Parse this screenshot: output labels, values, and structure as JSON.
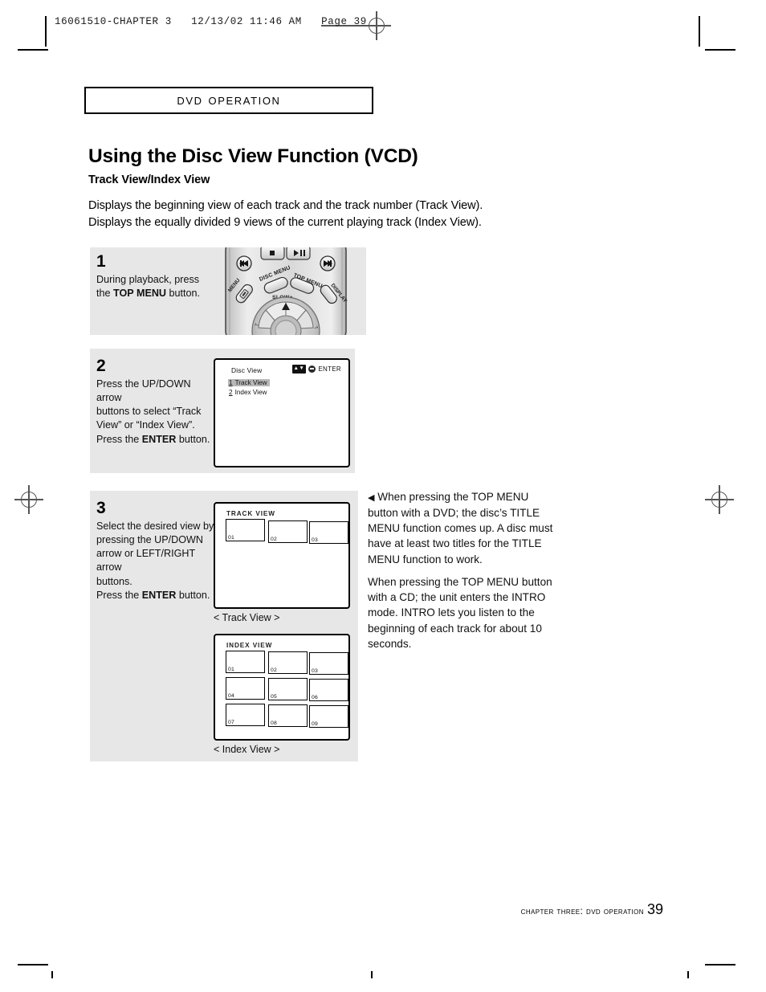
{
  "print_marks": {
    "slug": "16061510-CHAPTER 3   12/13/02 11:46 AM   Page 39"
  },
  "running_head": {
    "label": "DVD Operation"
  },
  "page": {
    "title": "Using the Disc View Function (VCD)",
    "subtitle": "Track View/Index View",
    "intro_line_1": "Displays the beginning view of each track and the track number (Track View).",
    "intro_line_2": "Displays the equally divided 9 views of the current playing track (Index View)."
  },
  "steps": [
    {
      "number": "1",
      "text_parts": [
        "During playback, press",
        "the ",
        "TOP MENU",
        " button."
      ],
      "line1": "During playback, press",
      "line2_pre": "the ",
      "line2_bold": "TOP MENU",
      "line2_post": " button."
    },
    {
      "number": "2",
      "line1": "Press the UP/DOWN arrow",
      "line2": "buttons to select “Track",
      "line3": "View” or “Index View”.",
      "line4_pre": "Press the ",
      "line4_bold": "ENTER",
      "line4_post": " button."
    },
    {
      "number": "3",
      "line1": "Select the desired view by",
      "line2": "pressing the UP/DOWN",
      "line3": "arrow or LEFT/RIGHT arrow",
      "line4": "buttons.",
      "line5_pre": "Press the ",
      "line5_bold": "ENTER",
      "line5_post": " button."
    }
  ],
  "remote": {
    "buttons": [
      {
        "name": "stop-button",
        "label": "■"
      },
      {
        "name": "play-pause-button",
        "label": "▶/II"
      },
      {
        "name": "skip-back-button",
        "label": "⏮"
      },
      {
        "name": "skip-forward-button",
        "label": "⏭"
      },
      {
        "name": "menu-button",
        "label": "MENU"
      },
      {
        "name": "disc-menu-button",
        "label": "DISC MENU"
      },
      {
        "name": "top-menu-button",
        "label": "TOP MENU"
      },
      {
        "name": "display-button",
        "label": "DISPLAY"
      },
      {
        "name": "slow-plus-label",
        "label": "SLOW+"
      }
    ]
  },
  "disc_view_osd": {
    "title": "Disc View",
    "badge_arrows": "▲▼",
    "badge_label": "ENTER",
    "items": [
      {
        "num": "1",
        "label": "Track View",
        "selected": true
      },
      {
        "num": "2",
        "label": "Index View",
        "selected": false
      }
    ]
  },
  "track_view_osd": {
    "title": "TRACK VIEW",
    "caption": "< Track View >",
    "thumbs": [
      "01",
      "02",
      "03"
    ]
  },
  "index_view_osd": {
    "title": "INDEX VIEW",
    "caption": "< Index View >",
    "thumbs": [
      "01",
      "02",
      "03",
      "04",
      "05",
      "06",
      "07",
      "08",
      "09"
    ]
  },
  "note": {
    "arrow": "◀",
    "paragraph_1": "When pressing the TOP MENU button with a DVD; the disc’s TITLE MENU function comes up. A disc must have at least two titles for the TITLE MENU function to work.",
    "paragraph_2": "When pressing the TOP MENU button with a CD; the unit enters the INTRO mode. INTRO lets you listen to the beginning of each track for about 10 seconds."
  },
  "footer": {
    "chapter": "Chapter Three: DVD Operation",
    "page_number": "39"
  },
  "colors": {
    "panel_bg": "#e7e7e7",
    "highlight": "#b8b8b8",
    "ink": "#000000"
  }
}
